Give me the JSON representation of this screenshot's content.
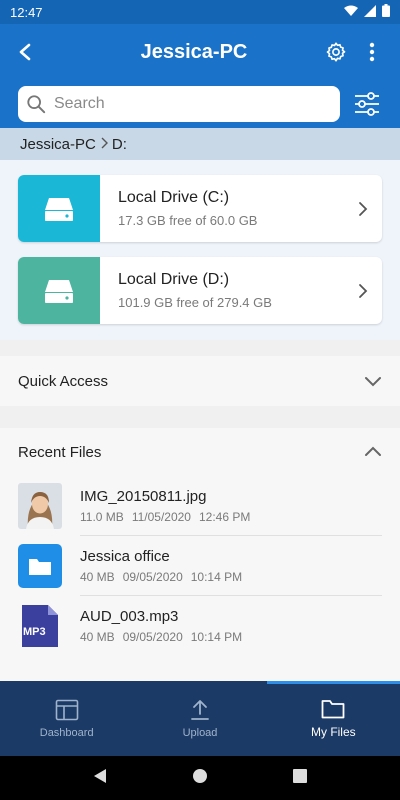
{
  "status": {
    "time": "12:47"
  },
  "header": {
    "title": "Jessica-PC"
  },
  "search": {
    "placeholder": "Search"
  },
  "breadcrumb": {
    "items": [
      "Jessica-PC",
      "D:"
    ]
  },
  "drives": [
    {
      "name": "Local Drive (C:)",
      "free": "17.3 GB free of 60.0 GB",
      "color": "#1ab8d6"
    },
    {
      "name": "Local Drive (D:)",
      "free": "101.9 GB free of 279.4 GB",
      "color": "#4db4a0"
    }
  ],
  "sections": {
    "quick_access": "Quick Access",
    "recent_files": "Recent Files"
  },
  "recent": [
    {
      "name": "IMG_20150811.jpg",
      "size": "11.0 MB",
      "date": "11/05/2020",
      "time": "12:46 PM",
      "type": "image"
    },
    {
      "name": "Jessica office",
      "size": "40 MB",
      "date": "09/05/2020",
      "time": "10:14 PM",
      "type": "folder"
    },
    {
      "name": "AUD_003.mp3",
      "size": "40 MB",
      "date": "09/05/2020",
      "time": "10:14 PM",
      "type": "mp3",
      "badge": "MP3"
    }
  ],
  "nav": {
    "dashboard": "Dashboard",
    "upload": "Upload",
    "my_files": "My Files",
    "active": "my_files"
  },
  "colors": {
    "primary": "#1a73c8",
    "nav_bg": "#1c3a66"
  }
}
